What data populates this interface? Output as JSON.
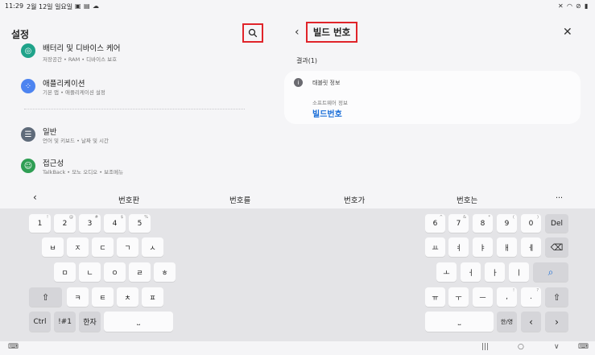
{
  "status_bar": {
    "time": "11:29",
    "date": "2월 12일 일요일",
    "left_icons": [
      "gallery-icon",
      "message-icon",
      "cloud-icon"
    ],
    "right_icons": [
      "mute-icon",
      "wifi-icon",
      "dnd-icon",
      "battery-icon"
    ]
  },
  "left_panel": {
    "title": "설정",
    "items": [
      {
        "title": "배터리 및 디바이스 케어",
        "sub": "저장공간 • RAM • 디바이스 보호",
        "icon": "device-care-icon",
        "color": "#1fa38a"
      },
      {
        "title": "애플리케이션",
        "sub": "기본 앱 • 애플리케이션 설정",
        "icon": "apps-icon",
        "color": "#4d84f0"
      },
      {
        "title": "일반",
        "sub": "언어 및 키보드 • 날짜 및 시간",
        "icon": "general-icon",
        "color": "#5f6b7a"
      },
      {
        "title": "접근성",
        "sub": "TalkBack • 모노 오디오 • 보조메뉴",
        "icon": "accessibility-icon",
        "color": "#2f9e54"
      }
    ]
  },
  "right_panel": {
    "search_query": "빌드 번호",
    "results_count": "결과(1)",
    "result": {
      "header": "태블릿 정보",
      "path": "소프트웨어 정보",
      "title": "빌드번호"
    }
  },
  "suggestions": {
    "back": "‹",
    "items": [
      "번호판",
      "번호를",
      "번호가",
      "번호는"
    ],
    "more": "···"
  },
  "keyboard_left": {
    "row1": [
      {
        "k": "1",
        "s": "!"
      },
      {
        "k": "2",
        "s": "@"
      },
      {
        "k": "3",
        "s": "#"
      },
      {
        "k": "4",
        "s": "$"
      },
      {
        "k": "5",
        "s": "%"
      }
    ],
    "row2": [
      "ㅂ",
      "ㅈ",
      "ㄷ",
      "ㄱ",
      "ㅅ"
    ],
    "row3": [
      "ㅁ",
      "ㄴ",
      "ㅇ",
      "ㄹ",
      "ㅎ"
    ],
    "row4": [
      "ㅋ",
      "ㅌ",
      "ㅊ",
      "ㅍ"
    ],
    "shift": "⇧",
    "ctrl": "Ctrl",
    "sym": "!#1",
    "lang": "한자",
    "space": "⎵"
  },
  "keyboard_right": {
    "row1": [
      {
        "k": "6",
        "s": "^"
      },
      {
        "k": "7",
        "s": "&"
      },
      {
        "k": "8",
        "s": "*"
      },
      {
        "k": "9",
        "s": "("
      },
      {
        "k": "0",
        "s": ")"
      }
    ],
    "del": "Del",
    "row2": [
      "ㅛ",
      "ㅕ",
      "ㅑ",
      "ㅐ",
      "ㅔ"
    ],
    "backspace": "⌫",
    "row3": [
      "ㅗ",
      "ㅓ",
      "ㅏ",
      "ㅣ"
    ],
    "search": "⌕",
    "row4": [
      "ㅠ",
      "ㅜ",
      "ㅡ",
      ",",
      ".",
      "⇧"
    ],
    "row4_sups": [
      "",
      "",
      "",
      "!",
      "?",
      ""
    ],
    "space": "⎵",
    "mode": "한/영",
    "left": "‹",
    "right": "›"
  },
  "nav_bar": {
    "keyboard_hide": "⌨",
    "recent": "|||",
    "home": "○",
    "back": "∨",
    "kb_switch": "⌨"
  }
}
